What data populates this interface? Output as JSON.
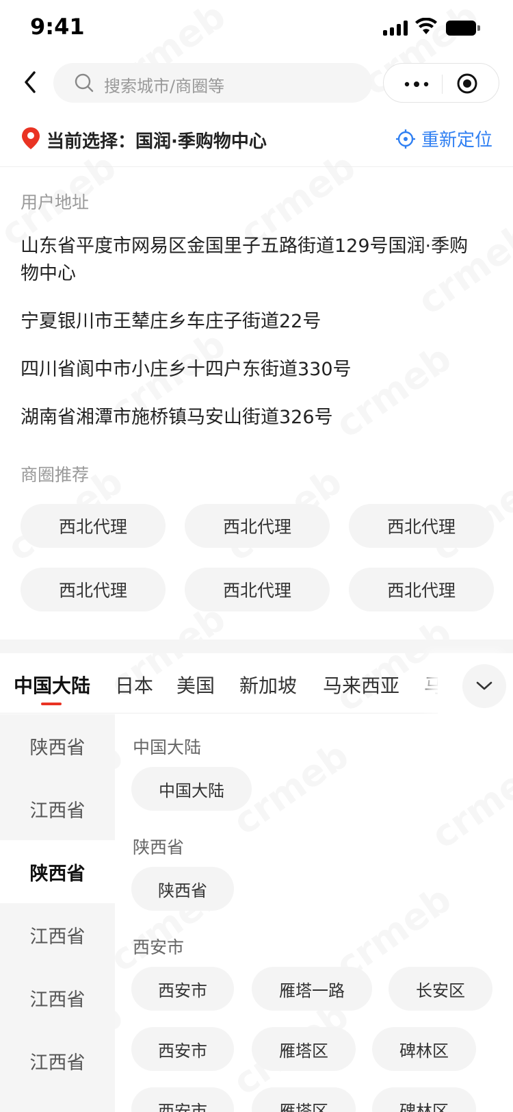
{
  "status_bar": {
    "time": "9:41"
  },
  "search": {
    "placeholder": "搜索城市/商圈等"
  },
  "current": {
    "text": "当前选择：国润·季购物中心",
    "relocate_label": "重新定位"
  },
  "user_address": {
    "title": "用户地址",
    "items": [
      "山东省平度市网易区金国里子五路街道129号国润·季购物中心",
      "宁夏银川市王辇庄乡车庄子街道22号",
      "四川省阆中市小庄乡十四户东街道330号",
      "湖南省湘潭市施桥镇马安山街道326号"
    ]
  },
  "recommend": {
    "title": "商圈推荐",
    "chips": [
      "西北代理",
      "西北代理",
      "西北代理",
      "西北代理",
      "西北代理",
      "西北代理"
    ]
  },
  "tabs": [
    "中国大陆",
    "日本",
    "美国",
    "新加坡",
    "马来西亚",
    "马来"
  ],
  "provinces": [
    "陕西省",
    "江西省",
    "陕西省",
    "江西省",
    "江西省",
    "江西省"
  ],
  "groups": [
    {
      "title": "中国大陆",
      "chips": [
        "中国大陆"
      ]
    },
    {
      "title": "陕西省",
      "chips": [
        "陕西省"
      ]
    },
    {
      "title": "西安市",
      "chips": [
        "西安市",
        "雁塔一路",
        "长安区",
        "西安市",
        "雁塔区",
        "碑林区",
        "西安市",
        "雁塔区",
        "碑林区"
      ]
    }
  ],
  "watermark": "crmeb",
  "colors": {
    "accent": "#e93323",
    "link": "#2f7ff2"
  }
}
